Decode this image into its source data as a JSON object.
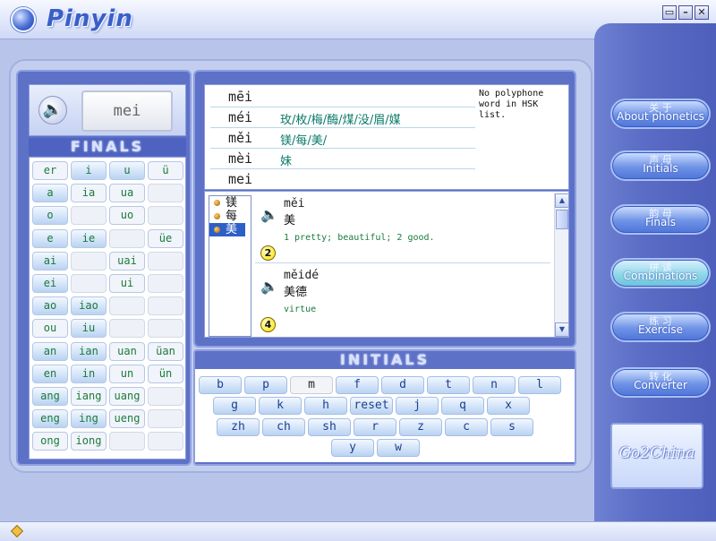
{
  "app": {
    "title": "Pinyin"
  },
  "window_buttons": [
    {
      "name": "restore-button",
      "glyph": "▭"
    },
    {
      "name": "minimize-button",
      "glyph": "–"
    },
    {
      "name": "close-button",
      "glyph": "✕"
    }
  ],
  "left_panel": {
    "current_syllable": "mei",
    "finals_header": "FINALS",
    "finals": [
      [
        "er",
        "i",
        "u",
        "ü"
      ],
      [
        "a",
        "ia",
        "ua",
        ""
      ],
      [
        "o",
        "",
        "uo",
        ""
      ],
      [
        "e",
        "ie",
        "",
        "üe"
      ],
      [
        "ai",
        "",
        "uai",
        ""
      ],
      [
        "ei",
        "",
        "ui",
        ""
      ],
      [
        "ao",
        "iao",
        "",
        ""
      ],
      [
        "ou",
        "iu",
        "",
        ""
      ],
      [
        "an",
        "ian",
        "uan",
        "üan"
      ],
      [
        "en",
        "in",
        "un",
        "ün"
      ],
      [
        "ang",
        "iang",
        "uang",
        ""
      ],
      [
        "eng",
        "ing",
        "ueng",
        ""
      ],
      [
        "ong",
        "iong",
        "",
        ""
      ]
    ],
    "finals_highlight": [
      [
        false,
        true,
        true,
        false
      ],
      [
        true,
        false,
        false,
        false
      ],
      [
        true,
        false,
        false,
        false
      ],
      [
        true,
        true,
        false,
        false
      ],
      [
        true,
        false,
        false,
        false
      ],
      [
        true,
        false,
        false,
        false
      ],
      [
        true,
        true,
        false,
        false
      ],
      [
        false,
        true,
        false,
        false
      ],
      [
        true,
        true,
        false,
        false
      ],
      [
        true,
        true,
        false,
        false
      ],
      [
        true,
        false,
        false,
        false
      ],
      [
        true,
        true,
        false,
        false
      ],
      [
        false,
        false,
        false,
        false
      ]
    ]
  },
  "tones": {
    "rows": [
      {
        "pinyin": "mēi",
        "chars": ""
      },
      {
        "pinyin": "méi",
        "chars": "玫/枚/梅/酶/煤/没/眉/媒"
      },
      {
        "pinyin": "měi",
        "chars": "镁/每/美/"
      },
      {
        "pinyin": "mèi",
        "chars": "妹"
      },
      {
        "pinyin": "mei",
        "chars": ""
      }
    ],
    "polyphone_note": "No polyphone word in HSK list."
  },
  "dictionary": {
    "char_list": [
      {
        "char": "镁",
        "selected": false
      },
      {
        "char": "每",
        "selected": false
      },
      {
        "char": "美",
        "selected": true
      }
    ],
    "entries": [
      {
        "pinyin": "měi",
        "hanzi": "美",
        "definition": "1 pretty; beautiful; 2 good.",
        "level": "2"
      },
      {
        "pinyin": "měidé",
        "hanzi": "美德",
        "definition": "virtue",
        "level": "4"
      }
    ]
  },
  "initials_panel": {
    "header": "INITIALS",
    "rows": [
      [
        "b",
        "p",
        "m",
        "f",
        "d",
        "t",
        "n",
        "l"
      ],
      [
        "g",
        "k",
        "h",
        "reset",
        "j",
        "q",
        "x"
      ],
      [
        "zh",
        "ch",
        "sh",
        "r",
        "z",
        "c",
        "s"
      ],
      [
        "y",
        "w"
      ]
    ],
    "selected": "m"
  },
  "nav": [
    {
      "cn": "关 于",
      "en": "About phonetics"
    },
    {
      "cn": "声 母",
      "en": "Initials"
    },
    {
      "cn": "韵 母",
      "en": "Finals"
    },
    {
      "cn": "拼 读",
      "en": "Combinations"
    },
    {
      "cn": "练 习",
      "en": "Exercise"
    },
    {
      "cn": "转 化",
      "en": "Converter"
    }
  ],
  "brand": {
    "text": "Go2China"
  },
  "colors": {
    "nav_bg": "#5a6cc5",
    "panel_bg": "#5d71c7",
    "final_text": "#1a7a3c",
    "tone_chars": "#0a7a6a"
  }
}
